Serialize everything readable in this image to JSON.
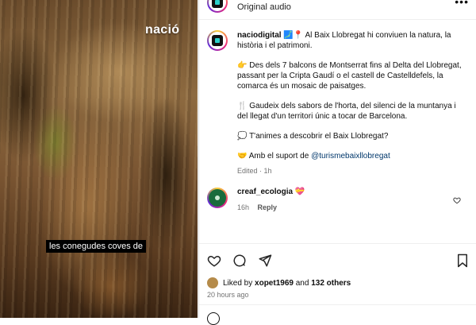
{
  "media": {
    "watermark": "nació",
    "caption": "les conegudes coves de"
  },
  "header": {
    "audio": "Original audio",
    "more_icon": "more-horizontal-icon"
  },
  "post": {
    "username": "naciodigital",
    "line1_emoji": "🗾📍",
    "line1_text": "Al Baix Llobregat hi conviuen la natura, la història i el patrimoni.",
    "para2_emoji": "👉",
    "para2_text": "Des dels 7 balcons de Montserrat fins al Delta del Llobregat, passant per la Cripta Gaudí o el castell de Castelldefels, la comarca és un mosaic de paisatges.",
    "para3_emoji": "🍴",
    "para3_text": "Gaudeix dels sabors de l'horta, del silenci de la muntanya i del llegat d'un territori únic a tocar de Barcelona.",
    "para4_emoji": "💭",
    "para4_text": "T'animes a descobrir el Baix Llobregat?",
    "para5_emoji": "🤝",
    "para5_text": "Amb el suport de",
    "mention": "@turismebaixllobregat",
    "meta": "Edited · 1h"
  },
  "comment": {
    "username": "creaf_ecologia",
    "emoji": "💝",
    "time": "16h",
    "reply_label": "Reply"
  },
  "actions": {
    "like_icon": "heart-icon",
    "comment_icon": "comment-icon",
    "share_icon": "send-icon",
    "save_icon": "bookmark-icon"
  },
  "likes": {
    "prefix": "Liked by",
    "user": "xopet1969",
    "and": "and",
    "others": "132 others",
    "time": "20 hours ago"
  }
}
